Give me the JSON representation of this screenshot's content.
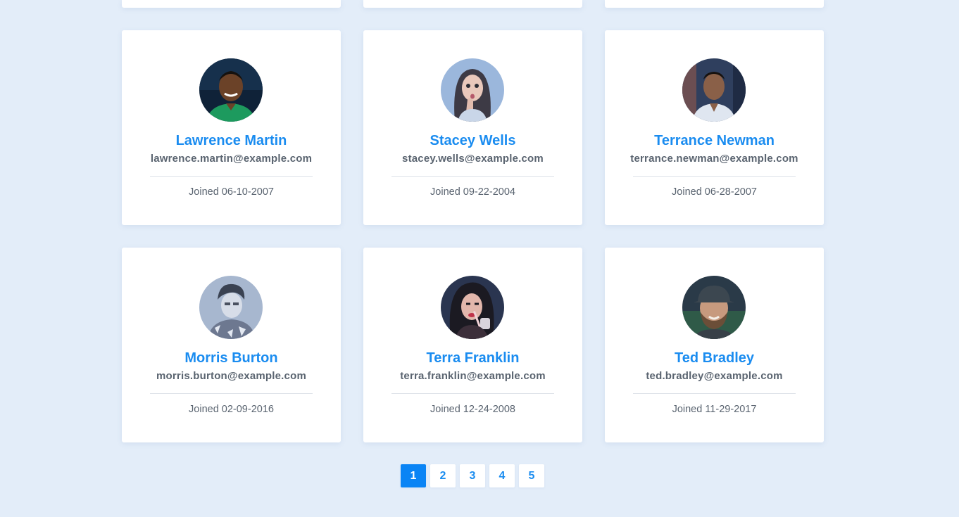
{
  "users": [
    {
      "name": "Lawrence Martin",
      "email": "lawrence.martin@example.com",
      "joined": "Joined 06-10-2007"
    },
    {
      "name": "Stacey Wells",
      "email": "stacey.wells@example.com",
      "joined": "Joined 09-22-2004"
    },
    {
      "name": "Terrance Newman",
      "email": "terrance.newman@example.com",
      "joined": "Joined 06-28-2007"
    },
    {
      "name": "Morris Burton",
      "email": "morris.burton@example.com",
      "joined": "Joined 02-09-2016"
    },
    {
      "name": "Terra Franklin",
      "email": "terra.franklin@example.com",
      "joined": "Joined 12-24-2008"
    },
    {
      "name": "Ted Bradley",
      "email": "ted.bradley@example.com",
      "joined": "Joined 11-29-2017"
    }
  ],
  "pagination": {
    "pages": [
      "1",
      "2",
      "3",
      "4",
      "5"
    ],
    "active": "1"
  },
  "colors": {
    "background": "#e3edf9",
    "accent": "#1a8cf0",
    "active_page": "#0a84f5",
    "text_muted": "#5a6470"
  }
}
